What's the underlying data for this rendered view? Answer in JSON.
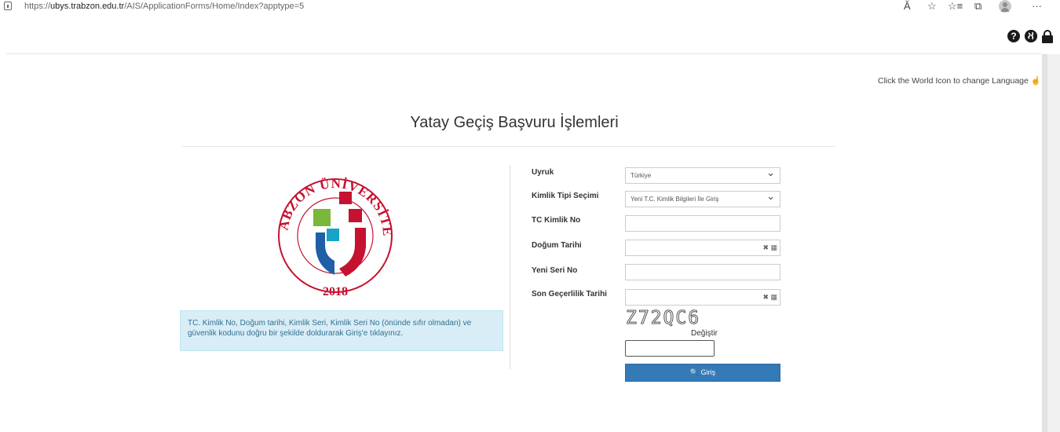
{
  "browser": {
    "url_prefix": "https://",
    "url_domain": "ubys.trabzon.edu.tr",
    "url_path": "/AIS/ApplicationForms/Home/Index?apptype=5",
    "read_aloud_glyph": "Ă",
    "favorite_glyph": "☆",
    "favorites_glyph": "☆≡",
    "collections_glyph": "⧉",
    "more_glyph": "···"
  },
  "header": {
    "help_glyph": "?",
    "world_glyph": "◐",
    "language_hint": "Click the World Icon to change Language ☝"
  },
  "page": {
    "title": "Yatay Geçiş Başvuru İşlemleri"
  },
  "logo": {
    "arc_text": "TRABZON ÜNİVERSİTESİ",
    "year": "2018"
  },
  "info": {
    "text": "TC. Kimlik No, Doğum tarihi, Kimlik Seri, Kimlik Seri No (önünde sıfır olmadan) ve güvenlik kodunu doğru bir şekilde doldurarak Giriş'e tıklayınız."
  },
  "form": {
    "nationality_label": "Uyruk",
    "nationality_value": "Türkiye",
    "id_type_label": "Kimlik Tipi Seçimi",
    "id_type_value": "Yeni T.C. Kimlik Bilgileri İle Giriş",
    "tc_label": "TC Kimlik No",
    "birthdate_label": "Doğum Tarihi",
    "serial_label": "Yeni Seri No",
    "expiry_label": "Son Geçerlilik Tarihi",
    "date_icons": "✖ ▦",
    "captcha_code": "Z72QC6",
    "change_label": "Değiştir",
    "submit_label": "🔍 Giriş"
  },
  "colors": {
    "primary": "#337ab7",
    "info_bg": "#d9edf7",
    "logo_red": "#c41230",
    "logo_blue": "#1f5fa8",
    "logo_green": "#7ab839",
    "logo_cyan": "#17a3c8"
  }
}
